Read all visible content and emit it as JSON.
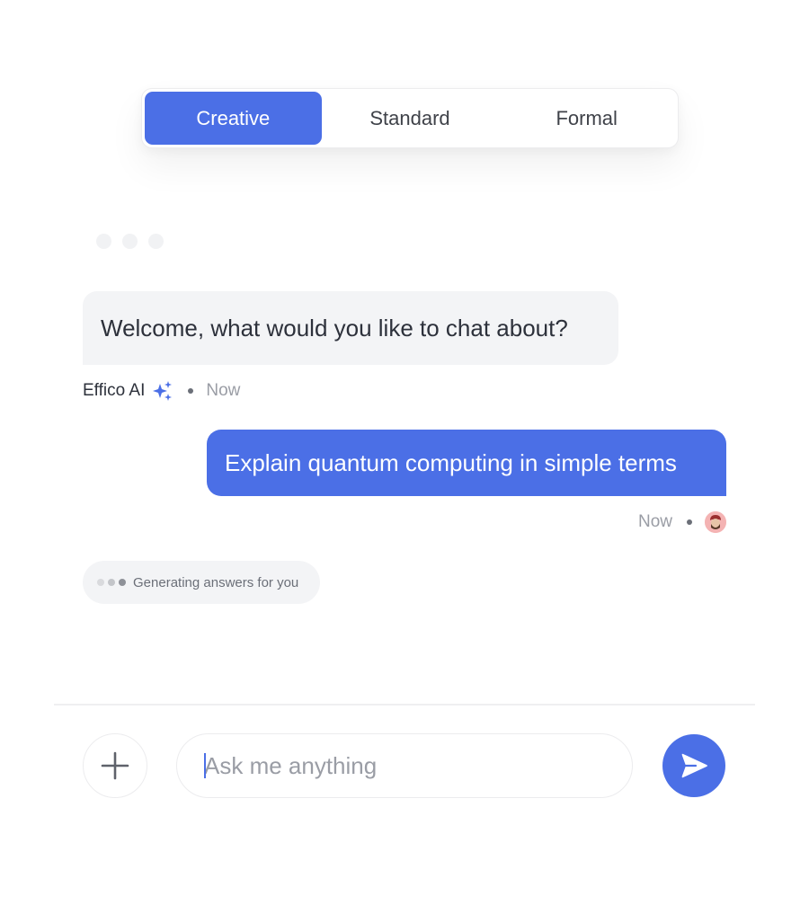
{
  "colors": {
    "accent": "#4b6fe6",
    "bubble_bg": "#f3f4f6",
    "muted_text": "#9a9da5"
  },
  "mode_selector": {
    "options": [
      {
        "label": "Creative",
        "selected": true
      },
      {
        "label": "Standard",
        "selected": false
      },
      {
        "label": "Formal",
        "selected": false
      }
    ]
  },
  "conversation": {
    "ai_message": {
      "text": "Welcome, what would you like to chat about?",
      "sender": "Effico AI",
      "sender_icon": "sparkle-icon",
      "time": "Now"
    },
    "user_message": {
      "text": "Explain quantum computing in simple terms",
      "time": "Now",
      "avatar": "user-avatar"
    },
    "status": {
      "text": "Generating answers for you",
      "dot_colors": [
        "#d9dadd",
        "#c3c5c9",
        "#8e9198"
      ]
    }
  },
  "composer": {
    "add_icon": "plus-icon",
    "placeholder": "Ask me anything",
    "value": "",
    "send_icon": "send-icon"
  }
}
